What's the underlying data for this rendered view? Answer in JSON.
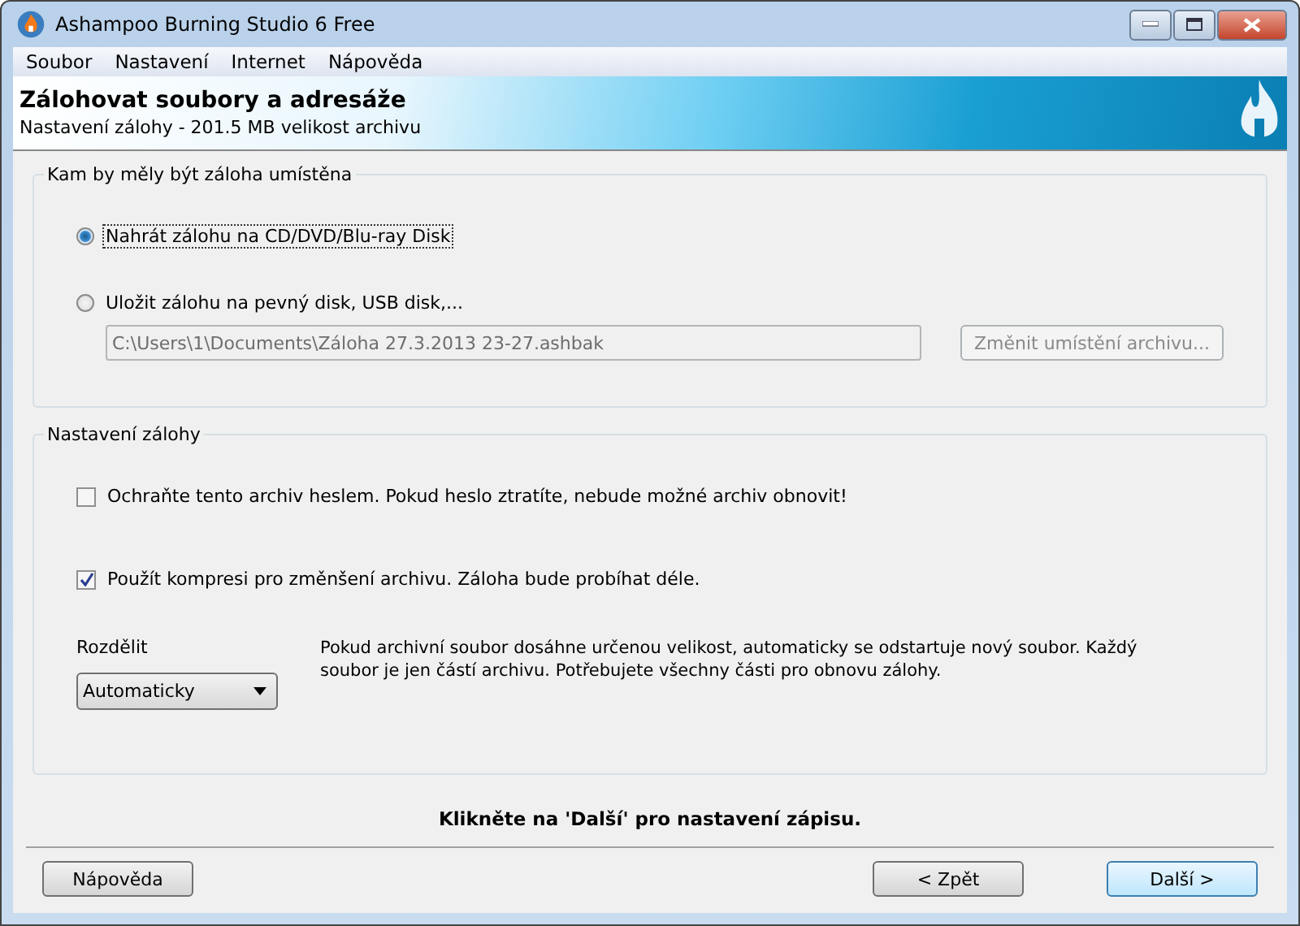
{
  "window": {
    "title": "Ashampoo Burning Studio 6 Free"
  },
  "menu": [
    "Soubor",
    "Nastavení",
    "Internet",
    "Nápověda"
  ],
  "header": {
    "title": "Zálohovat soubory a adresáže",
    "subtitle": "Nastavení zálohy - 201.5 MB velikost archivu"
  },
  "location_group": {
    "title": "Kam by měly být záloha umístěna",
    "options": [
      {
        "label": "Nahrát zálohu na CD/DVD/Blu-ray Disk",
        "selected": true
      },
      {
        "label": "Uložit zálohu na pevný disk, USB disk,...",
        "selected": false
      }
    ],
    "path": {
      "value": "C:\\Users\\1\\Documents\\Záloha 27.3.2013 23-27.ashbak",
      "disabled": true
    },
    "change_button": {
      "label": "Změnit umístění archivu...",
      "disabled": true
    }
  },
  "settings_group": {
    "title": "Nastavení zálohy",
    "checkboxes": [
      {
        "label": "Ochraňte tento archiv heslem. Pokud heslo ztratíte, nebude možné archiv obnovit!",
        "checked": false
      },
      {
        "label": "Použít kompresi pro změnšení archivu. Záloha bude probíhat déle.",
        "checked": true
      }
    ],
    "split": {
      "label": "Rozdělit",
      "value": "Automaticky",
      "description": "Pokud archivní soubor dosáhne určenou velikost, automaticky se odstartuje nový soubor. Každý soubor je jen částí archivu. Potřebujete všechny části pro obnovu zálohy."
    }
  },
  "hint": "Klikněte na 'Další' pro nastavení zápisu.",
  "buttons": [
    {
      "label": "Nápověda",
      "kind": "help",
      "default": false
    },
    {
      "label": "< Zpět",
      "kind": "back",
      "default": false
    },
    {
      "label": "Další >",
      "kind": "next",
      "default": true
    }
  ]
}
